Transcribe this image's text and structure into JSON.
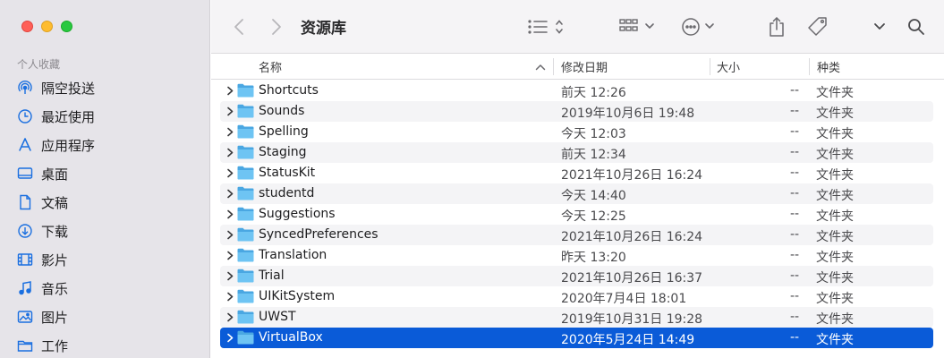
{
  "window": {
    "title": "资源库"
  },
  "sidebar": {
    "section_title": "个人收藏",
    "items": [
      {
        "label": "隔空投送",
        "icon": "airdrop-icon"
      },
      {
        "label": "最近使用",
        "icon": "clock-icon"
      },
      {
        "label": "应用程序",
        "icon": "applications-icon"
      },
      {
        "label": "桌面",
        "icon": "desktop-icon"
      },
      {
        "label": "文稿",
        "icon": "document-icon"
      },
      {
        "label": "下载",
        "icon": "download-icon"
      },
      {
        "label": "影片",
        "icon": "film-icon"
      },
      {
        "label": "音乐",
        "icon": "music-icon"
      },
      {
        "label": "图片",
        "icon": "photo-icon"
      },
      {
        "label": "工作",
        "icon": "folder-icon"
      }
    ]
  },
  "columns": {
    "name": "名称",
    "modified": "修改日期",
    "size": "大小",
    "kind": "种类"
  },
  "rows": [
    {
      "name": "Shortcuts",
      "date": "前天 12:26",
      "size": "--",
      "kind": "文件夹"
    },
    {
      "name": "Sounds",
      "date": "2019年10月6日 19:48",
      "size": "--",
      "kind": "文件夹"
    },
    {
      "name": "Spelling",
      "date": "今天 12:03",
      "size": "--",
      "kind": "文件夹"
    },
    {
      "name": "Staging",
      "date": "前天 12:34",
      "size": "--",
      "kind": "文件夹"
    },
    {
      "name": "StatusKit",
      "date": "2021年10月26日 16:24",
      "size": "--",
      "kind": "文件夹"
    },
    {
      "name": "studentd",
      "date": "今天 14:40",
      "size": "--",
      "kind": "文件夹"
    },
    {
      "name": "Suggestions",
      "date": "今天 12:25",
      "size": "--",
      "kind": "文件夹"
    },
    {
      "name": "SyncedPreferences",
      "date": "2021年10月26日 16:24",
      "size": "--",
      "kind": "文件夹"
    },
    {
      "name": "Translation",
      "date": "昨天 13:20",
      "size": "--",
      "kind": "文件夹"
    },
    {
      "name": "Trial",
      "date": "2021年10月26日 16:37",
      "size": "--",
      "kind": "文件夹"
    },
    {
      "name": "UIKitSystem",
      "date": "2020年7月4日 18:01",
      "size": "--",
      "kind": "文件夹"
    },
    {
      "name": "UWST",
      "date": "2019年10月31日 19:28",
      "size": "--",
      "kind": "文件夹"
    },
    {
      "name": "VirtualBox",
      "date": "2020年5月24日 14:49",
      "size": "--",
      "kind": "文件夹",
      "selected": true
    }
  ],
  "colors": {
    "selection": "#0a5bd8",
    "folder": "#5ab8ee",
    "sidebar": "#e6e4e9"
  }
}
